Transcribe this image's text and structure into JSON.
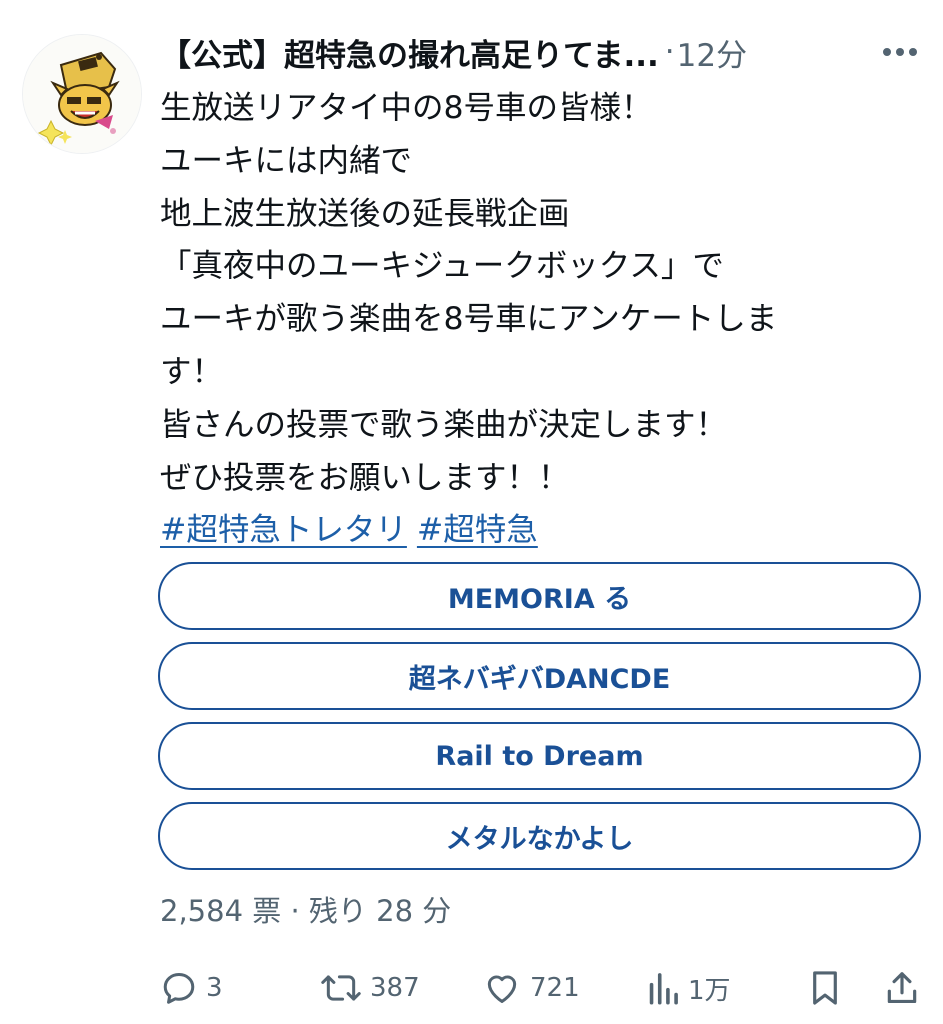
{
  "post": {
    "author_name": "【公式】超特急の撮れ高足りてま...",
    "separator": "·",
    "time": "12分",
    "body_lines": [
      "生放送リアタイ中の8号車の皆様！",
      "ユーキには内緒で",
      "地上波生放送後の延長戦企画",
      "「真夜中のユーキジュークボックス」で",
      "ユーキが歌う楽曲を8号車にアンケートしま",
      "す！",
      "皆さんの投票で歌う楽曲が決定します！",
      "ぜひ投票をお願いします！！"
    ],
    "hashtags": [
      "#超特急トレタリ",
      "#超特急"
    ]
  },
  "poll": {
    "options": [
      "MEMORIA る",
      "超ネバギバDANCDE",
      "Rail to Dream",
      "メタルなかよし"
    ],
    "footer": "2,584 票 · 残り 28 分"
  },
  "actions": {
    "reply_count": "3",
    "retweet_count": "387",
    "like_count": "721",
    "views_count": "1万"
  },
  "icons": {
    "more": "more-dots-icon",
    "reply": "reply-bubble-icon",
    "retweet": "retweet-icon",
    "like": "heart-icon",
    "views": "views-bar-chart-icon",
    "bookmark": "bookmark-icon",
    "share": "share-upload-icon"
  },
  "colors": {
    "text": "#0f1419",
    "muted": "#536471",
    "link": "#1d5fa8",
    "poll_border": "#1a5096"
  }
}
